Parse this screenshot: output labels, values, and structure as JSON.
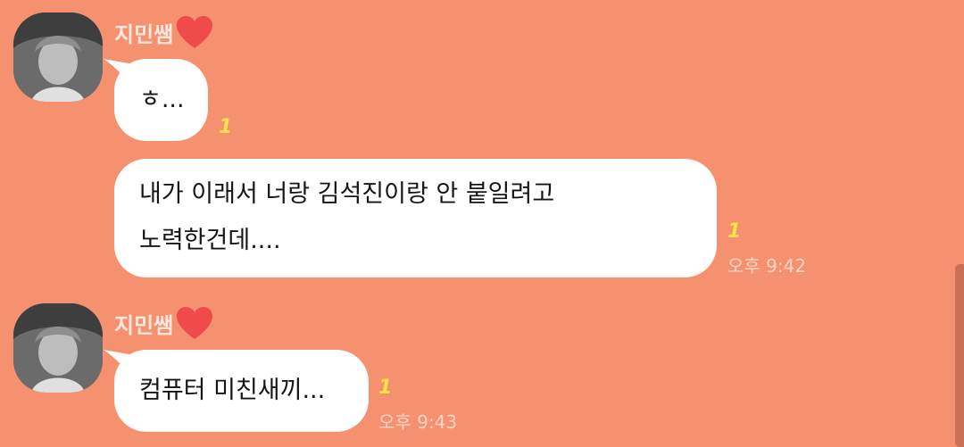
{
  "theme": {
    "background": "#f6916f",
    "bubble": "#ffffff",
    "unread_color": "#f6e347",
    "heart_color": "#f04b4b"
  },
  "messages": [
    {
      "sender": "지민쌤",
      "sender_icon": "heart-icon",
      "text": "ㅎ...",
      "unread": "1",
      "time": ""
    },
    {
      "sender": "",
      "text": "내가 이래서 너랑 김석진이랑 안 붙일려고\n노력한건데....",
      "unread": "1",
      "time": "오후 9:42"
    },
    {
      "sender": "지민쌤",
      "sender_icon": "heart-icon",
      "text": "컴퓨터 미친새끼...",
      "unread": "1",
      "time": "오후 9:43"
    }
  ]
}
